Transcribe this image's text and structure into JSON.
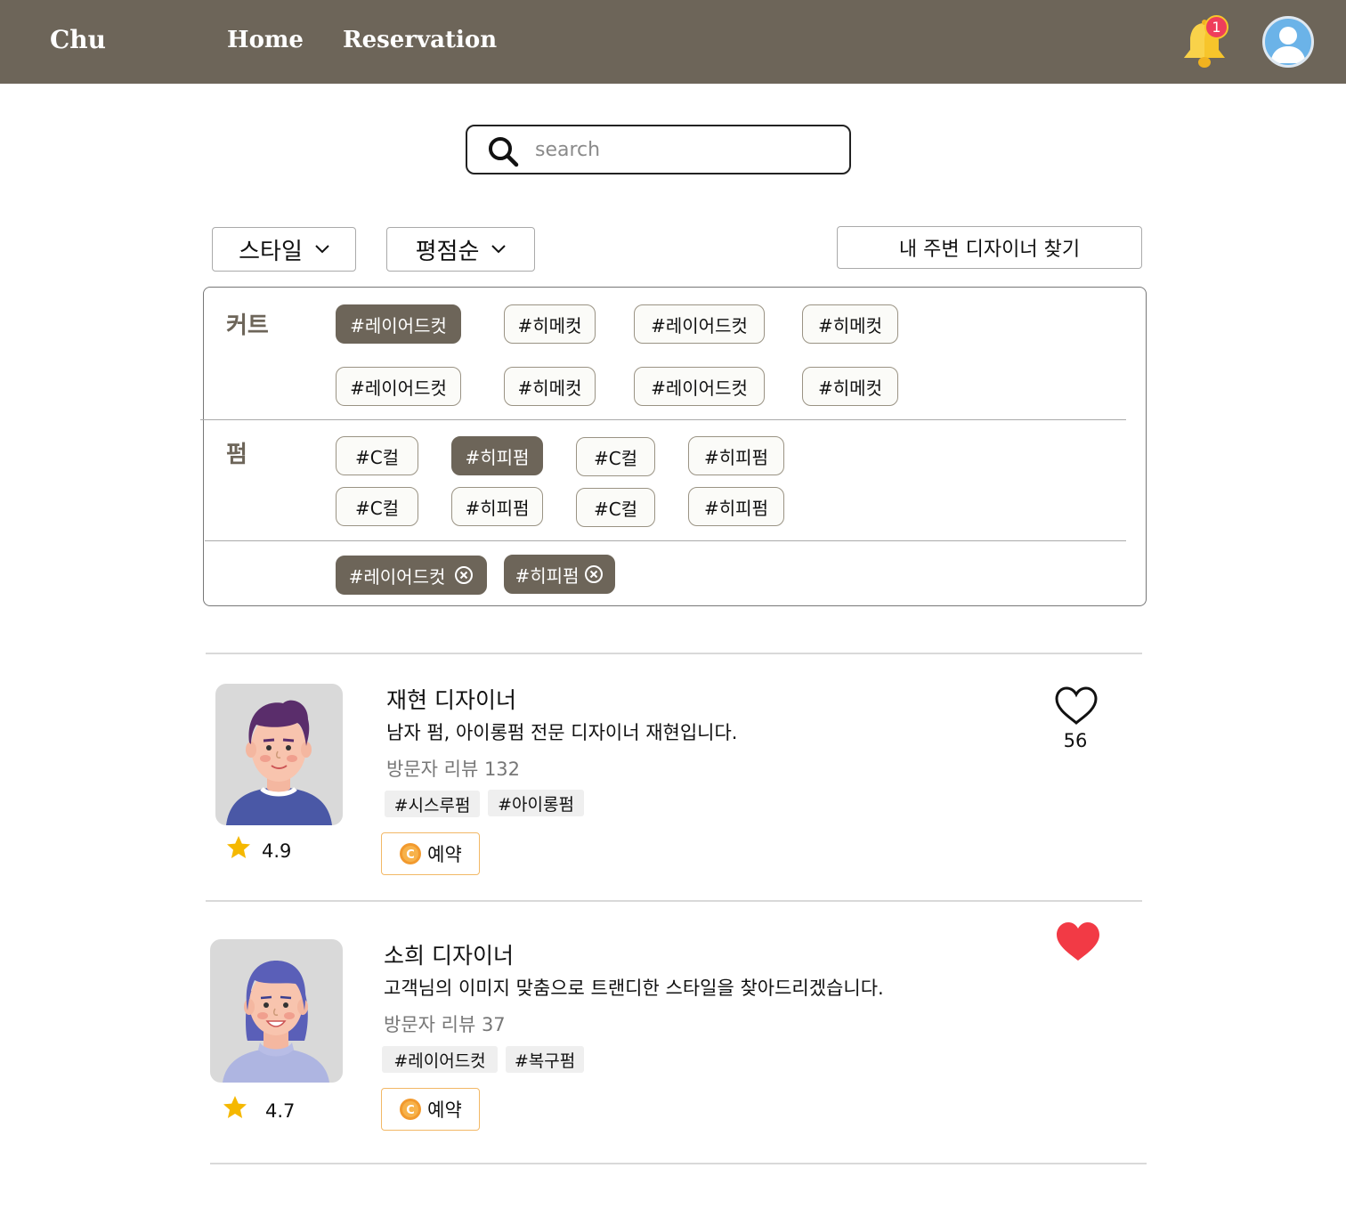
{
  "header": {
    "brand": "Chu",
    "nav": {
      "home": "Home",
      "reservation": "Reservation"
    },
    "notification_count": "1"
  },
  "search": {
    "placeholder": "search"
  },
  "filters": {
    "style_dropdown": "스타일",
    "rating_dropdown": "평점순",
    "nearby_button": "내 주변 디자이너 찾기"
  },
  "panel": {
    "cut_label": "커트",
    "cut_chips": [
      "#레이어드컷",
      "#히메컷",
      "#레이어드컷",
      "#히메컷",
      "#레이어드컷",
      "#히메컷",
      "#레이어드컷",
      "#히메컷"
    ],
    "perm_label": "펌",
    "perm_chips": [
      "#C컬",
      "#히피펌",
      "#C컬",
      "#히피펌",
      "#C컬",
      "#히피펌",
      "#C컬",
      "#히피펌"
    ],
    "selected_chips": [
      "#레이어드컷",
      "#히피펌"
    ]
  },
  "designers": [
    {
      "name": "재현 디자이너",
      "description": "남자 펌, 아이롱펌 전문 디자이너 재현입니다.",
      "reviews": "방문자 리뷰 132",
      "tags": [
        "#시스루펌",
        "#아이롱펌"
      ],
      "rating": "4.9",
      "reserve_label": "예약",
      "likes": "56",
      "liked": false
    },
    {
      "name": "소희 디자이너",
      "description": "고객님의 이미지 맞춤으로 트랜디한 스타일을 찾아드리겠습니다.",
      "reviews": "방문자 리뷰 37",
      "tags": [
        "#레이어드컷",
        "#복구펌"
      ],
      "rating": "4.7",
      "reserve_label": "예약",
      "liked": true
    }
  ],
  "colors": {
    "header_bg": "#6d6559",
    "chip_selected": "#6d6559",
    "heart_liked": "#f23a45",
    "star": "#f5b800",
    "reserve_border": "#f2b866"
  }
}
